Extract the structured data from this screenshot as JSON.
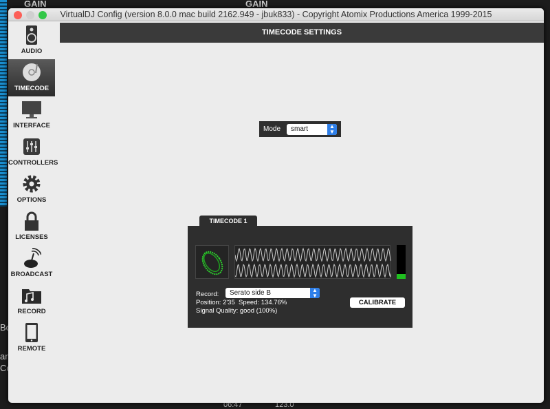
{
  "background": {
    "gain_left": "GAIN",
    "gain_right": "GAIN",
    "time": "06:47",
    "bpm": "123.0",
    "side_texts": [
      "Bo",
      "am",
      "Co"
    ]
  },
  "window": {
    "title": "VirtualDJ Config (version 8.0.0 mac build 2162.949 - jbuk833) - Copyright Atomix Productions America 1999-2015"
  },
  "sidebar": {
    "items": [
      {
        "label": "AUDIO",
        "icon": "speaker-icon"
      },
      {
        "label": "TIMECODE",
        "icon": "turntable-icon",
        "selected": true
      },
      {
        "label": "INTERFACE",
        "icon": "monitor-icon"
      },
      {
        "label": "CONTROLLERS",
        "icon": "sliders-icon"
      },
      {
        "label": "OPTIONS",
        "icon": "gear-icon"
      },
      {
        "label": "LICENSES",
        "icon": "lock-icon"
      },
      {
        "label": "BROADCAST",
        "icon": "antenna-icon"
      },
      {
        "label": "RECORD",
        "icon": "music-folder-icon"
      },
      {
        "label": "REMOTE",
        "icon": "phone-icon"
      }
    ]
  },
  "header": {
    "title": "TIMECODE SETTINGS"
  },
  "mode": {
    "label": "Mode",
    "value": "smart"
  },
  "timecode": {
    "tab": "TIMECODE 1",
    "record_label": "Record:",
    "record_value": "Serato side B",
    "position": "Position: 2'35  Speed: 134.76%",
    "quality": "Signal Quality: good (100%)",
    "calibrate": "CALIBRATE",
    "signal_level": 0.15,
    "accent": "#1fbf1f"
  }
}
